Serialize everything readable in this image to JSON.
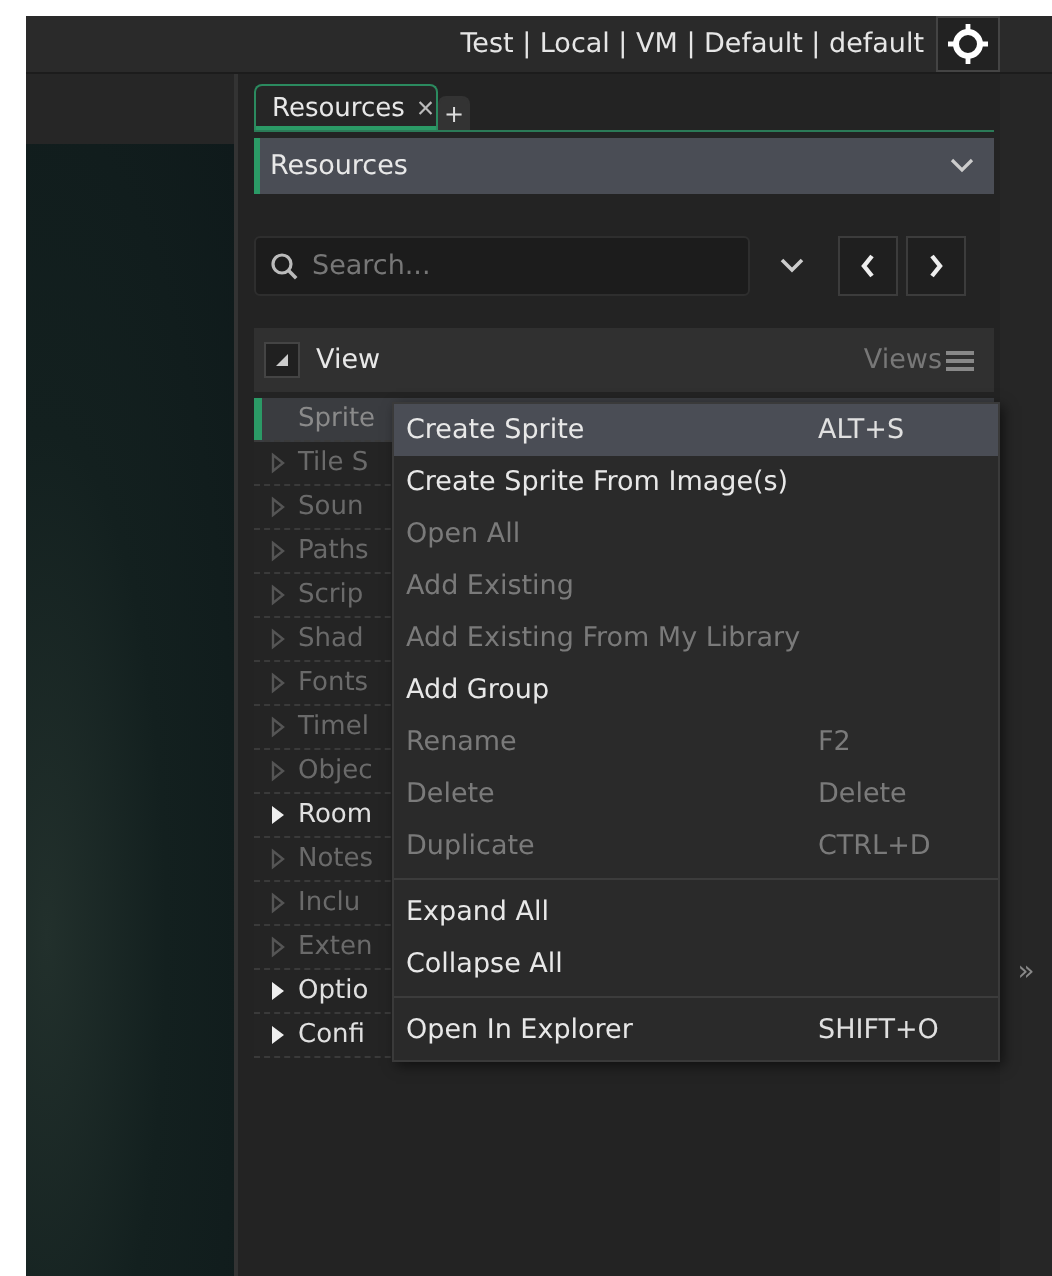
{
  "top_bar": {
    "config_text": "Test | Local | VM | Default | default"
  },
  "tabs": [
    {
      "label": "Resources",
      "close": "×",
      "selected": true
    },
    {
      "label": "+",
      "selected": false
    }
  ],
  "resource_dropdown": {
    "value": "Resources"
  },
  "search": {
    "placeholder": "Search..."
  },
  "view_header": {
    "title": "View",
    "views_label": "Views"
  },
  "tree": [
    {
      "label": "Sprite",
      "selected": true,
      "kind": "plain"
    },
    {
      "label": "Tile S",
      "selected": false,
      "kind": "empty"
    },
    {
      "label": "Soun",
      "selected": false,
      "kind": "empty"
    },
    {
      "label": "Paths",
      "selected": false,
      "kind": "empty"
    },
    {
      "label": "Scrip",
      "selected": false,
      "kind": "empty"
    },
    {
      "label": "Shad",
      "selected": false,
      "kind": "empty"
    },
    {
      "label": "Fonts",
      "selected": false,
      "kind": "empty"
    },
    {
      "label": "Timel",
      "selected": false,
      "kind": "empty"
    },
    {
      "label": "Objec",
      "selected": false,
      "kind": "empty"
    },
    {
      "label": "Room",
      "selected": false,
      "kind": "group"
    },
    {
      "label": "Notes",
      "selected": false,
      "kind": "empty"
    },
    {
      "label": "Inclu",
      "selected": false,
      "kind": "empty"
    },
    {
      "label": "Exten",
      "selected": false,
      "kind": "empty"
    },
    {
      "label": "Optio",
      "selected": false,
      "kind": "group"
    },
    {
      "label": "Confi",
      "selected": false,
      "kind": "group"
    }
  ],
  "context_menu": [
    {
      "kind": "item",
      "label": "Create Sprite",
      "shortcut": "ALT+S",
      "disabled": false,
      "selected": true
    },
    {
      "kind": "item",
      "label": "Create Sprite From Image(s)",
      "disabled": false,
      "selected": false
    },
    {
      "kind": "item",
      "label": "Open All",
      "disabled": true,
      "selected": false
    },
    {
      "kind": "item",
      "label": "Add Existing",
      "disabled": true,
      "selected": false
    },
    {
      "kind": "item",
      "label": "Add Existing From My Library",
      "disabled": true,
      "selected": false
    },
    {
      "kind": "item",
      "label": "Add Group",
      "disabled": false,
      "selected": false
    },
    {
      "kind": "item",
      "label": "Rename",
      "shortcut": "F2",
      "disabled": true,
      "selected": false
    },
    {
      "kind": "item",
      "label": "Delete",
      "shortcut": "Delete",
      "disabled": true,
      "selected": false
    },
    {
      "kind": "item",
      "label": "Duplicate",
      "shortcut": "CTRL+D",
      "disabled": true,
      "selected": false
    },
    {
      "kind": "separator"
    },
    {
      "kind": "item",
      "label": "Expand All",
      "disabled": false,
      "selected": false
    },
    {
      "kind": "item",
      "label": "Collapse All",
      "disabled": false,
      "selected": false
    },
    {
      "kind": "separator"
    },
    {
      "kind": "item",
      "label": "Open In Explorer",
      "shortcut": "SHIFT+O",
      "disabled": false,
      "selected": false
    }
  ],
  "side_gutter": {
    "expand_glyph": "»"
  }
}
